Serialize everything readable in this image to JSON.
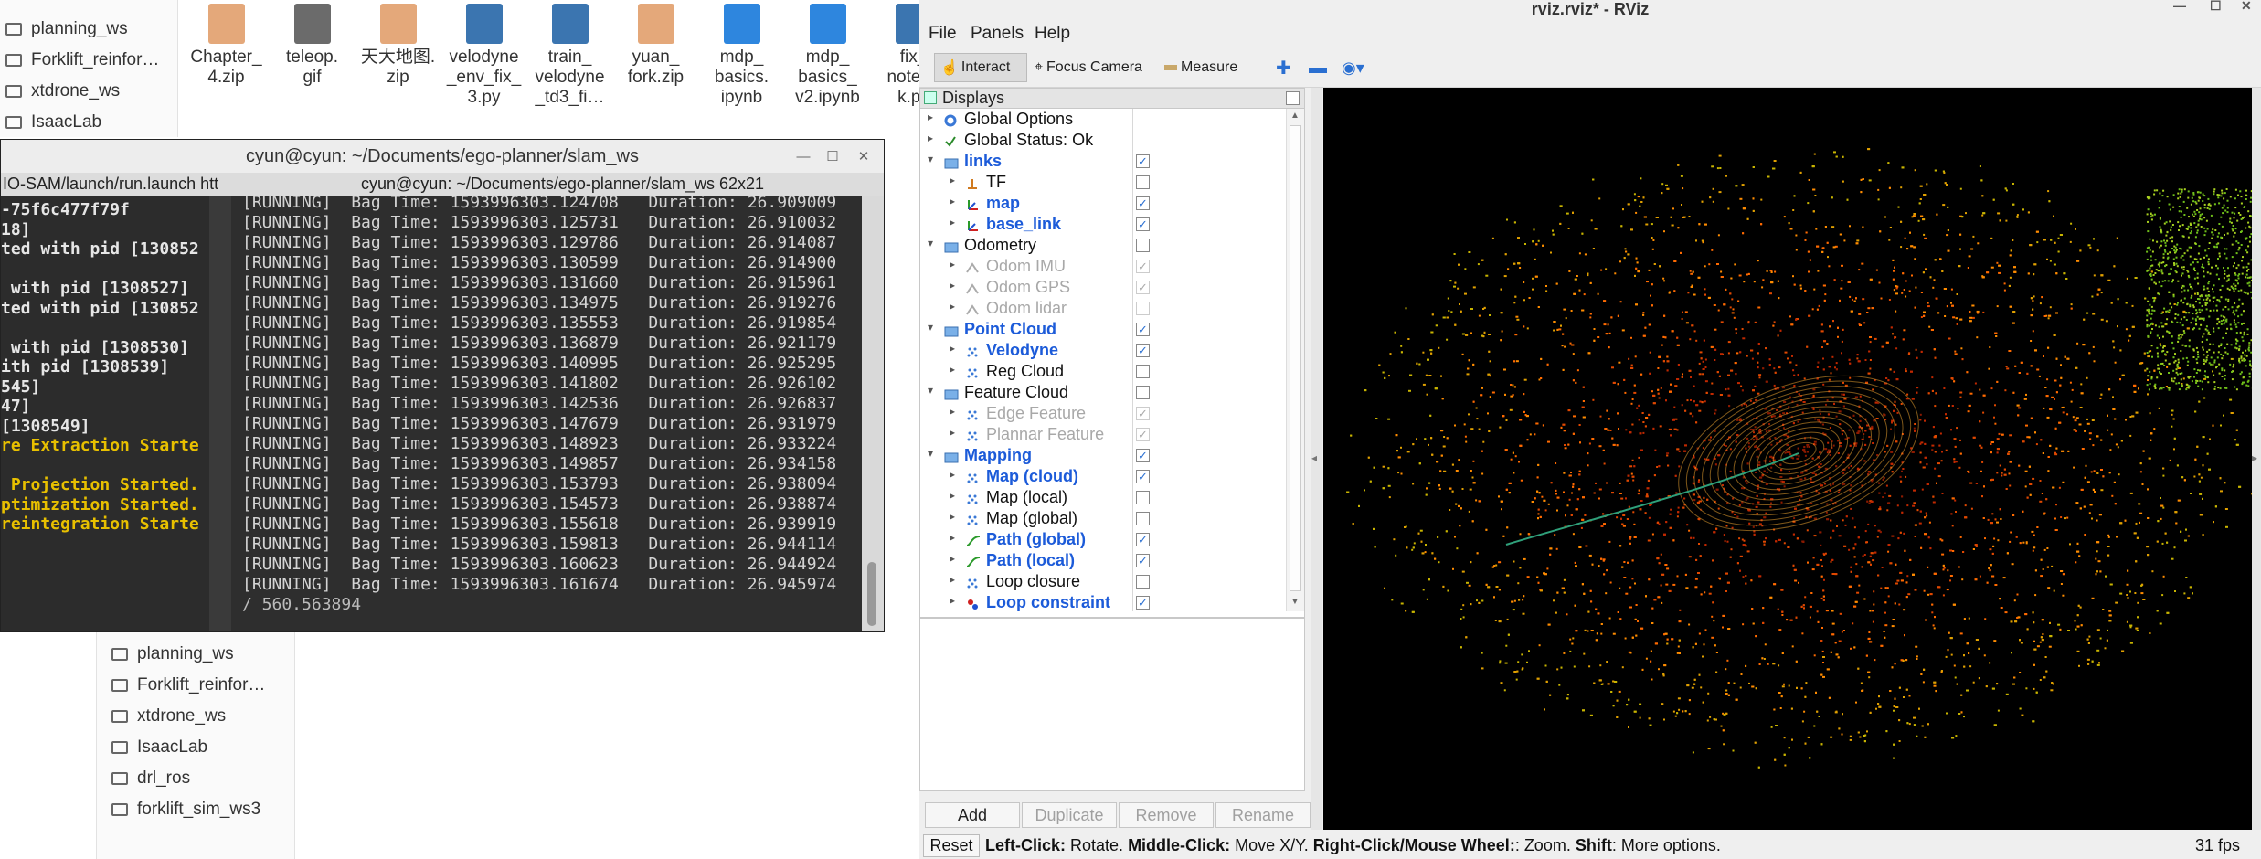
{
  "file_manager": {
    "sidebar_top": [
      "planning_ws",
      "Forklift_reinfor…",
      "xtdrone_ws",
      "IsaacLab"
    ],
    "sidebar_bottom": [
      "planning_ws",
      "Forklift_reinfor…",
      "xtdrone_ws",
      "IsaacLab",
      "drl_ros",
      "forklift_sim_ws3"
    ],
    "files": [
      {
        "name": [
          "Chapter_",
          "4.zip"
        ],
        "color": "#e4a87a"
      },
      {
        "name": [
          "teleop.",
          "gif"
        ],
        "color": "#6b6b6b"
      },
      {
        "name": [
          "天大地图.",
          "zip"
        ],
        "color": "#e4a87a"
      },
      {
        "name": [
          "velodyne",
          "_env_fix_",
          "3.py"
        ],
        "color": "#3b75b0"
      },
      {
        "name": [
          "train_",
          "velodyne",
          "_td3_fi…"
        ],
        "color": "#3b75b0"
      },
      {
        "name": [
          "yuan_",
          "fork.zip"
        ],
        "color": "#e4a87a"
      },
      {
        "name": [
          "mdp_",
          "basics.",
          "ipynb"
        ],
        "color": "#2e86de"
      },
      {
        "name": [
          "mdp_",
          "basics_",
          "v2.ipynb"
        ],
        "color": "#2e86de"
      },
      {
        "name": [
          "fix_",
          "notebo",
          "k.py"
        ],
        "color": "#3b75b0"
      }
    ]
  },
  "terminal": {
    "title": "cyun@cyun: ~/Documents/ego-planner/slam_ws",
    "tab_left": "IO-SAM/launch/run.launch htt",
    "tab_right": "cyun@cyun: ~/Documents/ego-planner/slam_ws 62x21",
    "left_lines": [
      {
        "t": "-75f6c477f79f",
        "o": false
      },
      {
        "t": "18]",
        "o": false
      },
      {
        "t": "ted with pid [130852",
        "o": false
      },
      {
        "t": "",
        "o": false
      },
      {
        "t": " with pid [1308527]",
        "o": false
      },
      {
        "t": "ted with pid [130852",
        "o": false
      },
      {
        "t": "",
        "o": false
      },
      {
        "t": " with pid [1308530]",
        "o": false
      },
      {
        "t": "ith pid [1308539]",
        "o": false
      },
      {
        "t": "545]",
        "o": false
      },
      {
        "t": "47]",
        "o": false
      },
      {
        "t": "[1308549]",
        "o": false
      },
      {
        "t": "re Extraction Starte",
        "o": true
      },
      {
        "t": "",
        "o": false
      },
      {
        "t": " Projection Started.",
        "o": true
      },
      {
        "t": "ptimization Started.",
        "o": true
      },
      {
        "t": "reintegration Starte",
        "o": true
      }
    ],
    "running_lines": [
      {
        "time": "1593996303.124708",
        "dur": "26.909009"
      },
      {
        "time": "1593996303.125731",
        "dur": "26.910032"
      },
      {
        "time": "1593996303.129786",
        "dur": "26.914087"
      },
      {
        "time": "1593996303.130599",
        "dur": "26.914900"
      },
      {
        "time": "1593996303.131660",
        "dur": "26.915961"
      },
      {
        "time": "1593996303.134975",
        "dur": "26.919276"
      },
      {
        "time": "1593996303.135553",
        "dur": "26.919854"
      },
      {
        "time": "1593996303.136879",
        "dur": "26.921179"
      },
      {
        "time": "1593996303.140995",
        "dur": "26.925295"
      },
      {
        "time": "1593996303.141802",
        "dur": "26.926102"
      },
      {
        "time": "1593996303.142536",
        "dur": "26.926837"
      },
      {
        "time": "1593996303.147679",
        "dur": "26.931979"
      },
      {
        "time": "1593996303.148923",
        "dur": "26.933224"
      },
      {
        "time": "1593996303.149857",
        "dur": "26.934158"
      },
      {
        "time": "1593996303.153793",
        "dur": "26.938094"
      },
      {
        "time": "1593996303.154573",
        "dur": "26.938874"
      },
      {
        "time": "1593996303.155618",
        "dur": "26.939919"
      },
      {
        "time": "1593996303.159813",
        "dur": "26.944114"
      },
      {
        "time": "1593996303.160623",
        "dur": "26.944924"
      },
      {
        "time": "1593996303.161674",
        "dur": "26.945974"
      }
    ],
    "running_prefix": "[RUNNING]  Bag Time: ",
    "duration_prefix": "   Duration: ",
    "prompt_line": "/ 560.563894"
  },
  "rviz": {
    "title": "rviz.rviz* - RViz",
    "menu": [
      "File",
      "Panels",
      "Help"
    ],
    "toolbar": {
      "interact": "Interact",
      "focus": "Focus Camera",
      "measure": "Measure"
    },
    "displays_title": "Displays",
    "rows": [
      {
        "label": "Global Options",
        "indent": 0,
        "style": "normal",
        "check": null,
        "icon": "gear",
        "exp": "▸"
      },
      {
        "label": "Global Status: Ok",
        "indent": 0,
        "style": "normal",
        "check": null,
        "icon": "ok",
        "exp": "▸"
      },
      {
        "label": "links",
        "indent": 0,
        "style": "blue",
        "check": true,
        "icon": "folder",
        "exp": "▾"
      },
      {
        "label": "TF",
        "indent": 1,
        "style": "normal",
        "check": false,
        "icon": "tf",
        "exp": "▸"
      },
      {
        "label": "map",
        "indent": 1,
        "style": "blue",
        "check": true,
        "icon": "axes",
        "exp": "▸"
      },
      {
        "label": "base_link",
        "indent": 1,
        "style": "blue",
        "check": true,
        "icon": "axes",
        "exp": "▸"
      },
      {
        "label": "Odometry",
        "indent": 0,
        "style": "normal",
        "check": false,
        "icon": "folder",
        "exp": "▾"
      },
      {
        "label": "Odom IMU",
        "indent": 1,
        "style": "grey",
        "check": "dis",
        "icon": "odom",
        "exp": "▸"
      },
      {
        "label": "Odom GPS",
        "indent": 1,
        "style": "grey",
        "check": "dis",
        "icon": "odom",
        "exp": "▸"
      },
      {
        "label": "Odom lidar",
        "indent": 1,
        "style": "grey",
        "check": "disoff",
        "icon": "odom",
        "exp": "▸"
      },
      {
        "label": "Point Cloud",
        "indent": 0,
        "style": "blue",
        "check": true,
        "icon": "folder",
        "exp": "▾"
      },
      {
        "label": "Velodyne",
        "indent": 1,
        "style": "blue",
        "check": true,
        "icon": "cloud",
        "exp": "▸"
      },
      {
        "label": "Reg Cloud",
        "indent": 1,
        "style": "normal",
        "check": false,
        "icon": "cloud",
        "exp": "▸"
      },
      {
        "label": "Feature Cloud",
        "indent": 0,
        "style": "normal",
        "check": false,
        "icon": "folder",
        "exp": "▾"
      },
      {
        "label": "Edge Feature",
        "indent": 1,
        "style": "grey",
        "check": "dis",
        "icon": "cloud",
        "exp": "▸"
      },
      {
        "label": "Plannar Feature",
        "indent": 1,
        "style": "grey",
        "check": "dis",
        "icon": "cloud",
        "exp": "▸"
      },
      {
        "label": "Mapping",
        "indent": 0,
        "style": "blue",
        "check": true,
        "icon": "folder",
        "exp": "▾"
      },
      {
        "label": "Map (cloud)",
        "indent": 1,
        "style": "blue",
        "check": true,
        "icon": "cloud",
        "exp": "▸"
      },
      {
        "label": "Map (local)",
        "indent": 1,
        "style": "normal",
        "check": false,
        "icon": "cloud",
        "exp": "▸"
      },
      {
        "label": "Map (global)",
        "indent": 1,
        "style": "normal",
        "check": false,
        "icon": "cloud",
        "exp": "▸"
      },
      {
        "label": "Path (global)",
        "indent": 1,
        "style": "blue",
        "check": true,
        "icon": "path",
        "exp": "▸"
      },
      {
        "label": "Path (local)",
        "indent": 1,
        "style": "blue",
        "check": true,
        "icon": "path",
        "exp": "▸"
      },
      {
        "label": "Loop closure",
        "indent": 1,
        "style": "normal",
        "check": false,
        "icon": "cloud",
        "exp": "▸"
      },
      {
        "label": "Loop constraint",
        "indent": 1,
        "style": "blue",
        "check": true,
        "icon": "marker",
        "exp": "▸"
      }
    ],
    "buttons": {
      "add": "Add",
      "duplicate": "Duplicate",
      "remove": "Remove",
      "rename": "Rename"
    },
    "status": {
      "reset": "Reset",
      "left_b": "Left-Click:",
      "left": " Rotate. ",
      "mid_b": "Middle-Click:",
      "mid": " Move X/Y. ",
      "right_b": "Right-Click/Mouse Wheel:",
      "right": ": Zoom. ",
      "shift_b": "Shift",
      "shift": ": More options.",
      "fps": "31 fps"
    }
  }
}
